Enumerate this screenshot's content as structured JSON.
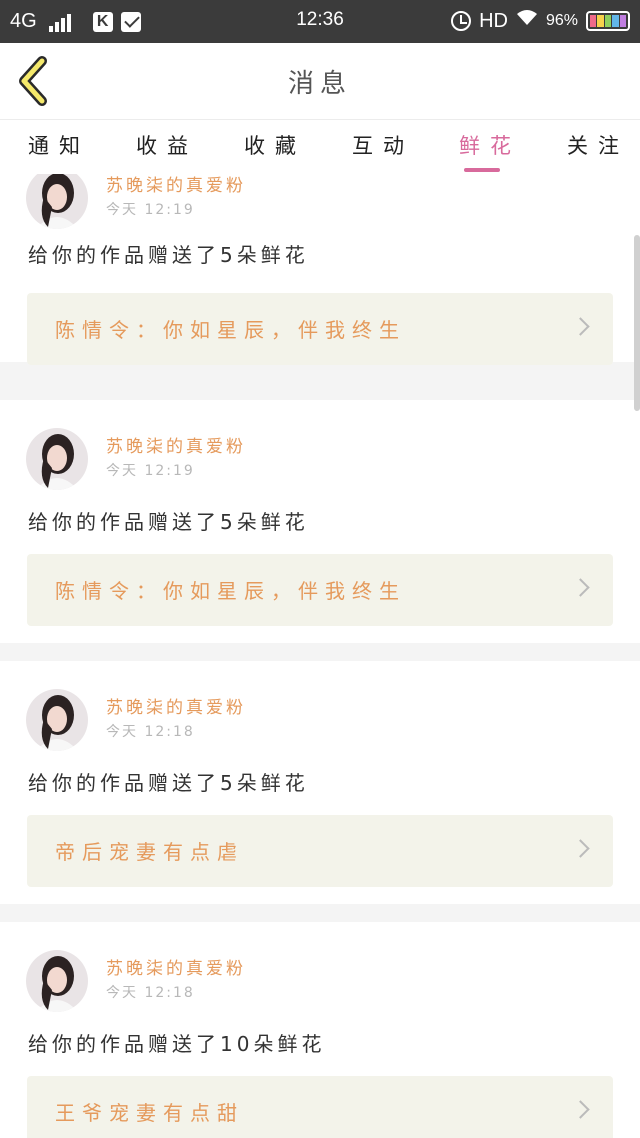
{
  "status_bar": {
    "network": "4G",
    "app_icon_k": "K",
    "time": "12:36",
    "hd": "HD",
    "battery": "96%"
  },
  "header": {
    "title": "消息",
    "back_icon": "chevron-left-icon"
  },
  "tabs": [
    {
      "label": "通知"
    },
    {
      "label": "收益"
    },
    {
      "label": "收藏"
    },
    {
      "label": "互动"
    },
    {
      "label": "鲜花",
      "active": true
    },
    {
      "label": "关注"
    }
  ],
  "items": [
    {
      "user": "苏晚柒的真爱粉",
      "time": "今天 12:19",
      "message": "给你的作品赠送了5朵鲜花",
      "work": "陈情令：你如星辰，伴我终生"
    },
    {
      "user": "苏晚柒的真爱粉",
      "time": "今天 12:19",
      "message": "给你的作品赠送了5朵鲜花",
      "work": "陈情令：你如星辰，伴我终生"
    },
    {
      "user": "苏晚柒的真爱粉",
      "time": "今天 12:18",
      "message": "给你的作品赠送了5朵鲜花",
      "work": "帝后宠妻有点虐"
    },
    {
      "user": "苏晚柒的真爱粉",
      "time": "今天 12:18",
      "message": "给你的作品赠送了10朵鲜花",
      "work": "王爷宠妻有点甜"
    }
  ],
  "colors": {
    "accent_pink": "#d86a9c",
    "orange_text": "#e59a5c",
    "back_yellow": "#f5e96b"
  }
}
